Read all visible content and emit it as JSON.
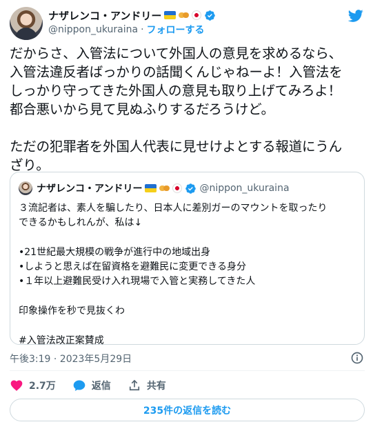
{
  "author": {
    "display_name": "ナザレンコ・アンドリー",
    "handle": "@nippon_ukuraina",
    "separator": "·",
    "follow_label": "フォローする",
    "emoji_icons": [
      "ukraine-flag-icon",
      "handshake-icon",
      "japan-flag-icon"
    ],
    "verified": true
  },
  "tweet": {
    "lines": [
      "だからさ、入管法について外国人の意見を求めるなら、",
      "入管法違反者ばっかりの話聞くんじゃねーよ！入管法を",
      "しっかり守ってきた外国人の意見も取り上げてみろよ！",
      "都合悪いから見て見ぬふりするだろうけど。",
      "",
      "ただの犯罪者を外国人代表に見せけよとする報道にうん",
      "ざり。"
    ]
  },
  "quoted_tweet": {
    "display_name": "ナザレンコ・アンドリー",
    "handle": "@nippon_ukuraina",
    "lines": [
      "３流記者は、素人を騙したり、日本人に差別ガーのマウントを取ったり",
      "できるかもしれんが、私は↓",
      "",
      "•21世紀最大規模の戦争が進行中の地域出身",
      "•しようと思えば在留資格を避難民に変更できる身分",
      "•１年以上避難民受け入れ現場で入管と実務してきた人",
      "",
      "印象操作を秒で見抜くわ",
      "",
      "#入管法改正案賛成"
    ]
  },
  "meta": {
    "timestamp": "午後3:19 · 2023年5月29日"
  },
  "actions": {
    "like_count": "2.7万",
    "reply_label": "返信",
    "share_label": "共有"
  },
  "read_replies_label": "235件の返信を読む",
  "colors": {
    "accent": "#1d9bf0",
    "like": "#f91880",
    "text": "#0f1419",
    "secondary": "#536471",
    "border": "#cfd9de"
  }
}
